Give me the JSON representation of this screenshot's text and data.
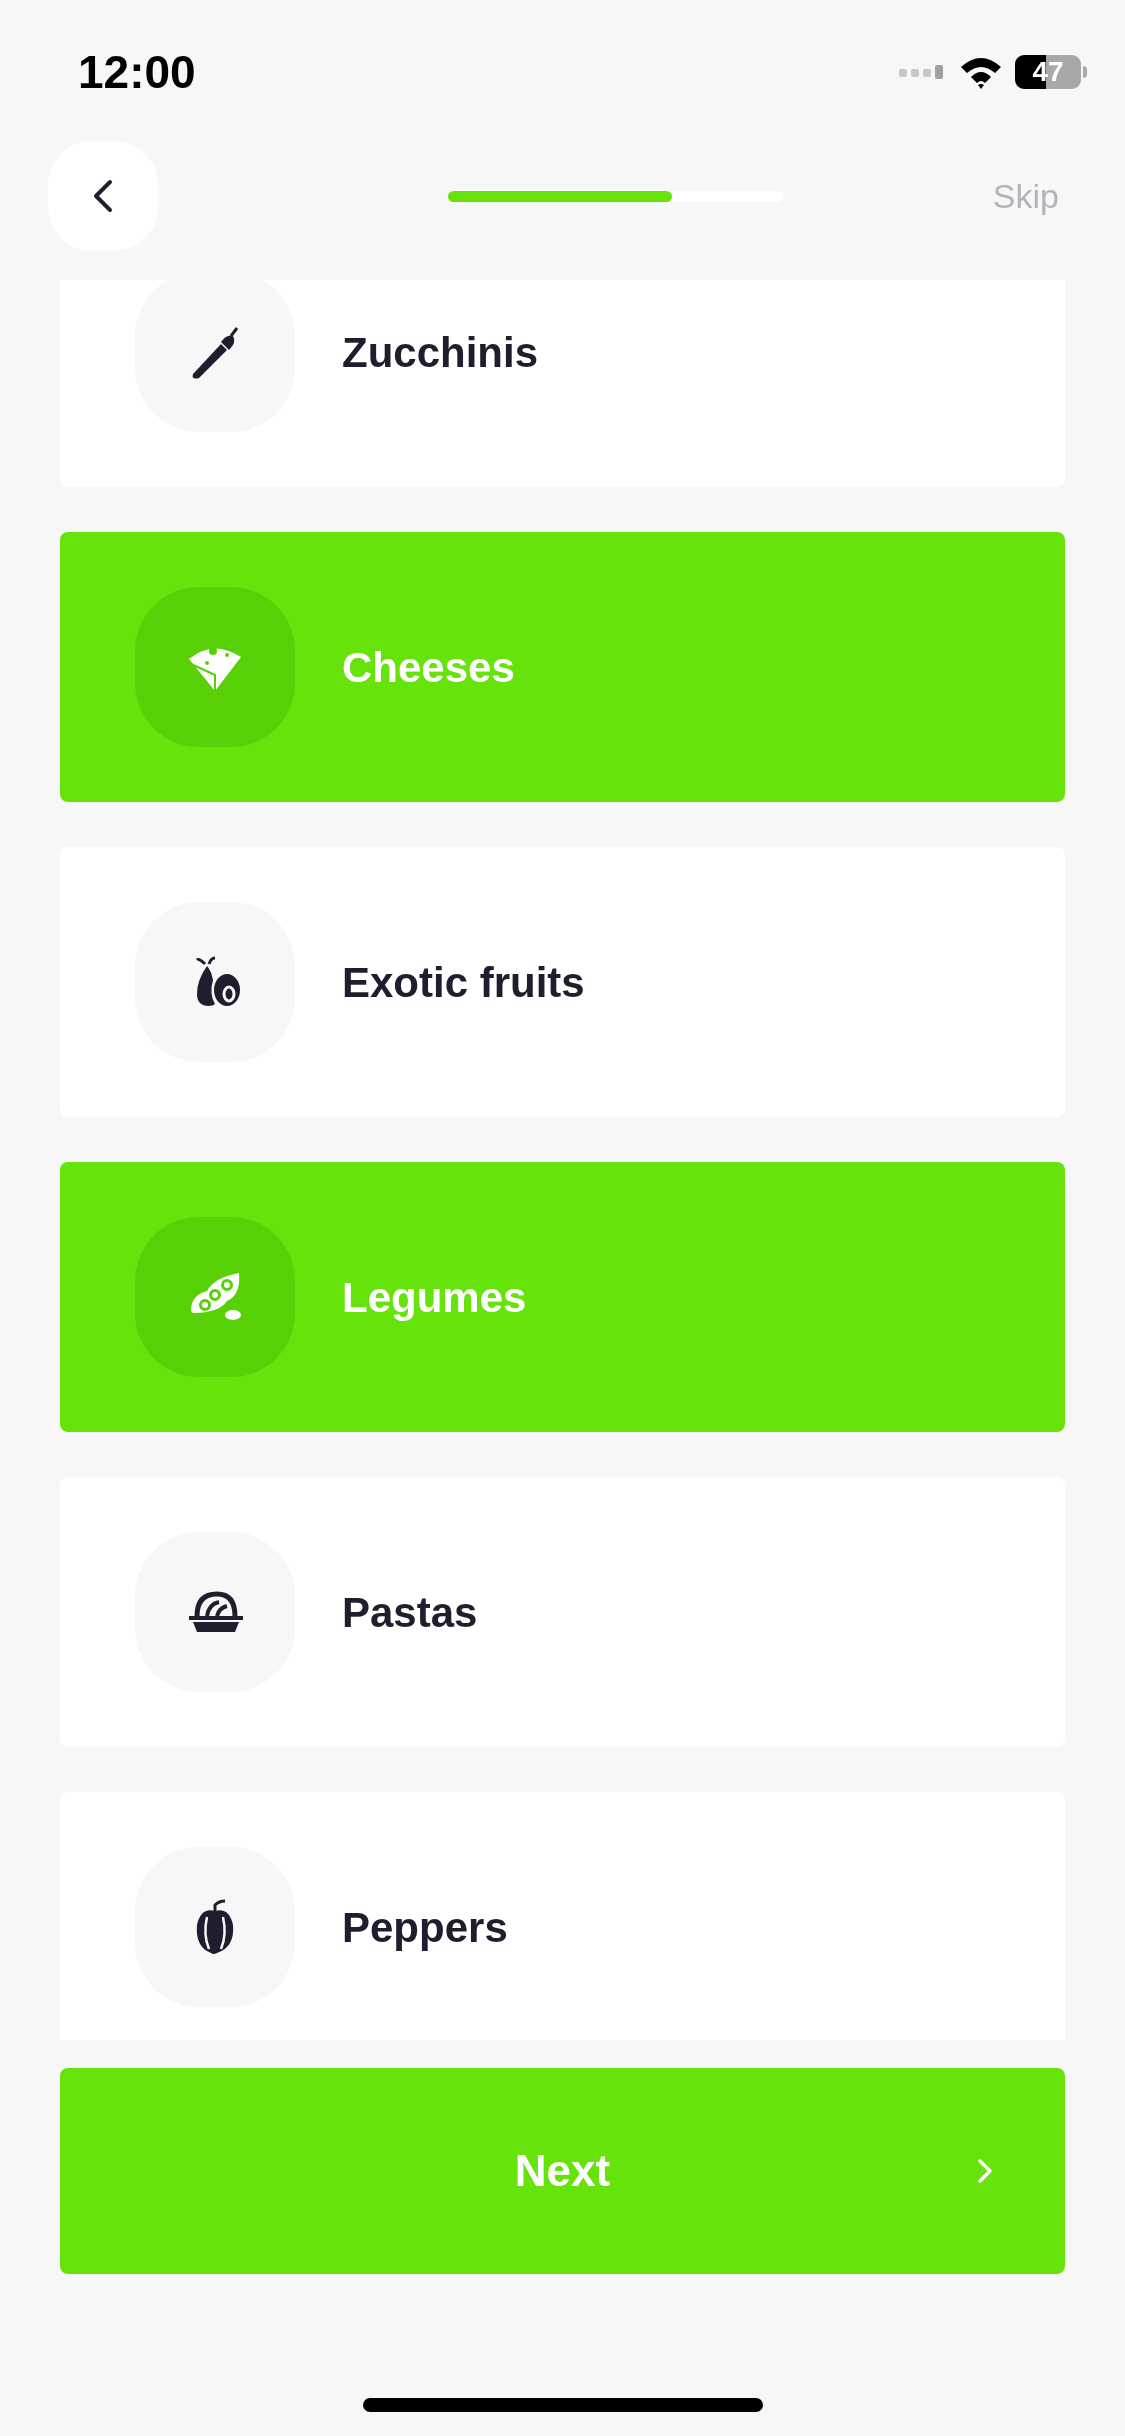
{
  "status_bar": {
    "time": "12:00",
    "battery": "47"
  },
  "header": {
    "progress": {
      "level": 0.67
    },
    "skip": "Skip"
  },
  "items": [
    {
      "label": "Zucchinis",
      "selected": false,
      "kind": "zucchini"
    },
    {
      "label": "Cheeses",
      "selected": true,
      "kind": "cheese"
    },
    {
      "label": "Exotic fruits",
      "selected": false,
      "kind": "avocado"
    },
    {
      "label": "Legumes",
      "selected": true,
      "kind": "peas"
    },
    {
      "label": "Pastas",
      "selected": false,
      "kind": "pasta"
    },
    {
      "label": "Peppers",
      "selected": false,
      "kind": "pepper"
    }
  ],
  "next_button": {
    "label": "Next"
  }
}
